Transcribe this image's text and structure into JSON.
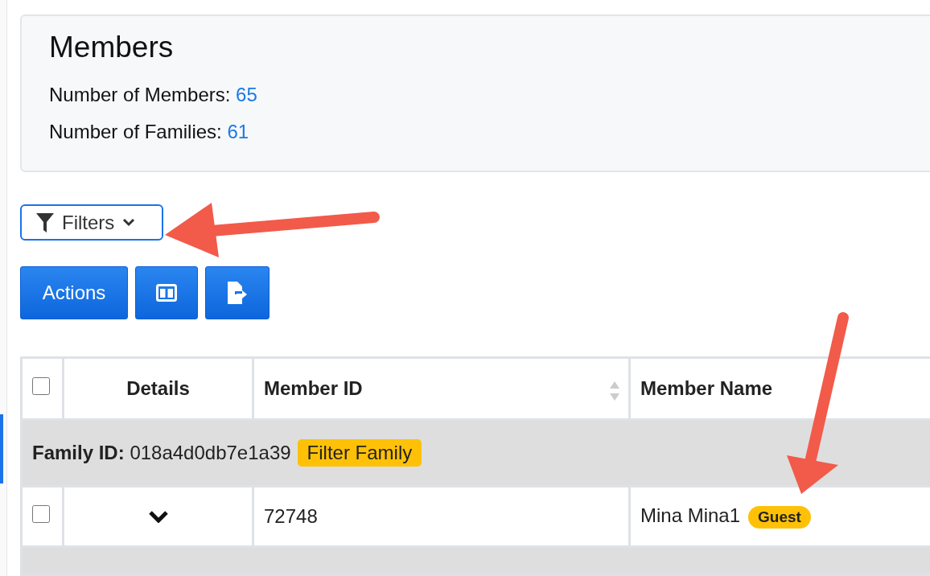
{
  "page": {
    "title": "Members",
    "stats": [
      {
        "label": "Number of Members:",
        "value": "65"
      },
      {
        "label": "Number of Families:",
        "value": "61"
      }
    ]
  },
  "filters_button": {
    "label": "Filters"
  },
  "toolbar": {
    "actions_label": "Actions"
  },
  "table": {
    "select_all_checked": false,
    "columns": [
      {
        "label": "Details",
        "kind": "toggle"
      },
      {
        "label": "Member ID",
        "kind": "sortable"
      },
      {
        "label": "Member Name",
        "kind": "text"
      }
    ],
    "groups": [
      {
        "label": "Family ID:",
        "value": "018a4d0db7e1a39",
        "tag": "Filter Family",
        "rows": [
          {
            "checked": false,
            "expanded": false,
            "member_id": "72748",
            "name": "Mina Mina1",
            "badge": "Guest"
          }
        ]
      }
    ]
  }
}
